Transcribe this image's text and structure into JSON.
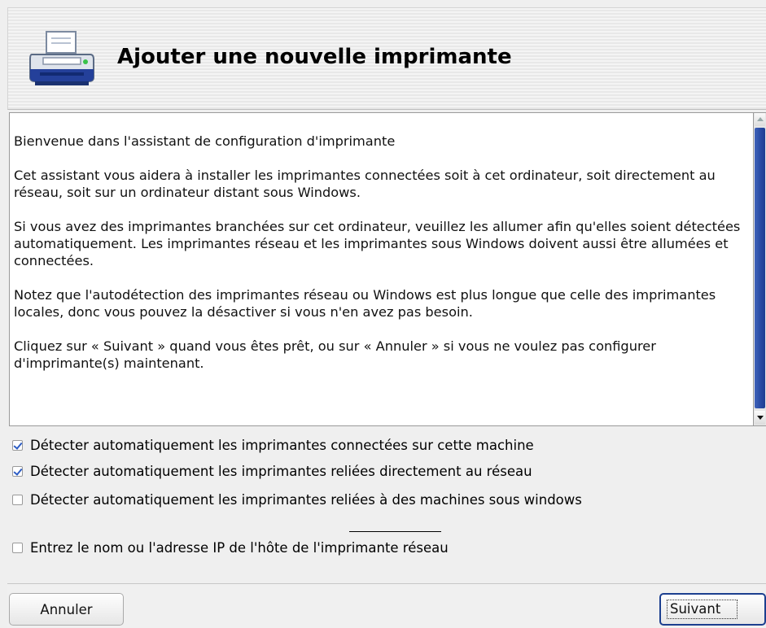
{
  "header": {
    "title": "Ajouter une nouvelle imprimante",
    "icon": "printer-icon"
  },
  "intro": {
    "paragraphs": [
      "Bienvenue dans l'assistant de configuration d'imprimante",
      "Cet assistant vous aidera à installer les imprimantes connectées soit à cet ordinateur, soit directement au réseau, soit sur un ordinateur distant sous Windows.",
      "Si vous avez des imprimantes branchées sur cet ordinateur, veuillez les allumer afin qu'elles soient détectées automatiquement. Les imprimantes réseau et les imprimantes sous Windows doivent aussi être allumées et connectées.",
      "Notez que l'autodétection des imprimantes réseau ou Windows est plus longue que celle des imprimantes locales, donc vous pouvez la désactiver si vous n'en avez pas besoin.",
      "Cliquez sur « Suivant » quand vous êtes prêt, ou sur « Annuler » si vous ne voulez pas configurer d'imprimante(s) maintenant."
    ]
  },
  "options": [
    {
      "label": "Détecter automatiquement les imprimantes connectées sur cette machine",
      "checked": true
    },
    {
      "label": "Détecter automatiquement les imprimantes reliées directement au réseau",
      "checked": true
    },
    {
      "label": "Détecter automatiquement les imprimantes reliées à des machines sous windows",
      "checked": false
    },
    {
      "label": "Entrez le nom ou l'adresse IP de l'hôte de l'imprimante réseau",
      "checked": false
    }
  ],
  "buttons": {
    "cancel": "Annuler",
    "next": "Suivant"
  },
  "colors": {
    "accent": "#2749a2",
    "check": "#2d5dc4"
  }
}
